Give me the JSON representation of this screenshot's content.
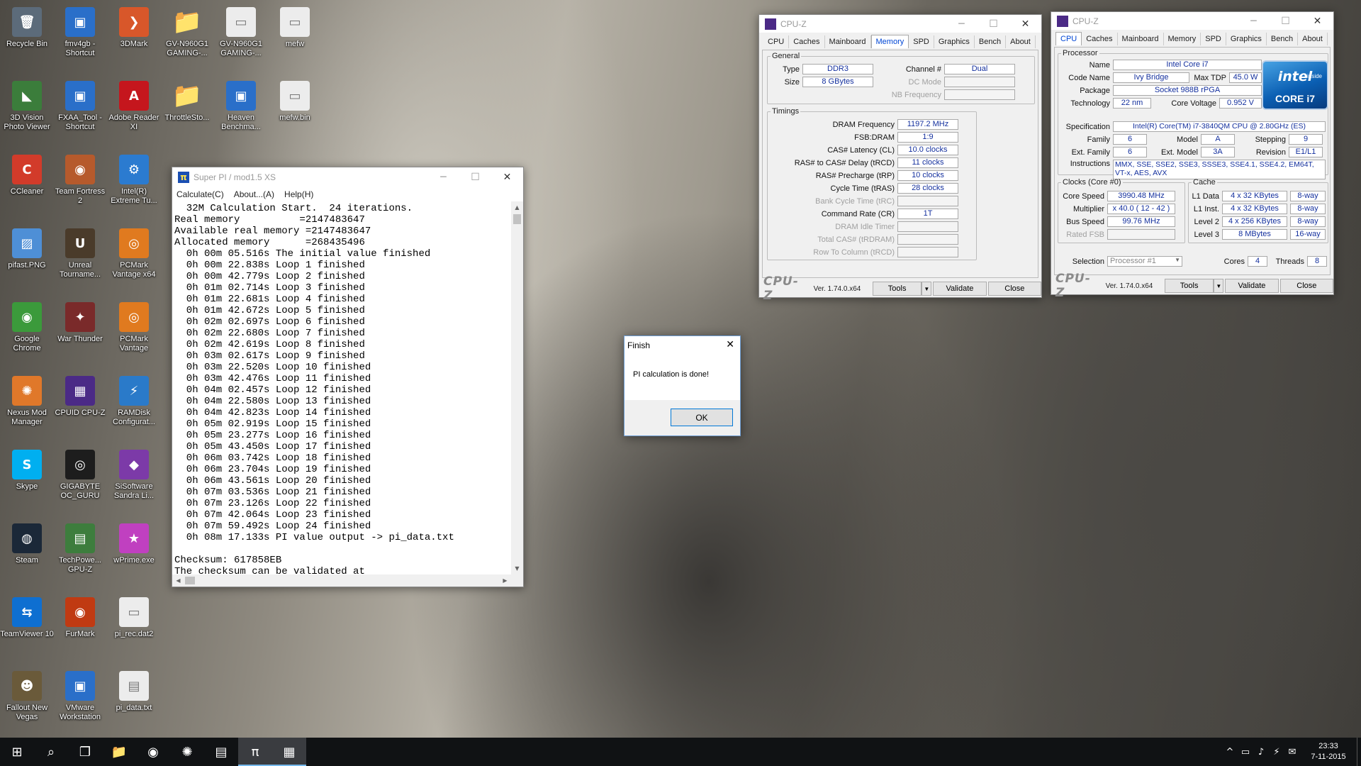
{
  "desktop": {
    "icons": [
      {
        "label": "Recycle Bin",
        "glyph": "🗑",
        "color": "#5c6b7a"
      },
      {
        "label": "fmv4gb - Shortcut",
        "glyph": "▣",
        "color": "#2a6fc9"
      },
      {
        "label": "3DMark",
        "glyph": "❯",
        "color": "#d8572a"
      },
      {
        "label": "GV-N960G1 GAMING-...",
        "glyph": "📁",
        "color": "#e8b94a"
      },
      {
        "label": "GV-N960G1 GAMING-...",
        "glyph": "▭",
        "color": "#ececec"
      },
      {
        "label": "mefw",
        "glyph": "▭",
        "color": "#ececec"
      },
      {
        "label": "3D Vision Photo Viewer",
        "glyph": "◣",
        "color": "#3b7d3b"
      },
      {
        "label": "FXAA_Tool - Shortcut",
        "glyph": "▣",
        "color": "#2a6fc9"
      },
      {
        "label": "Adobe Reader XI",
        "glyph": "A",
        "color": "#c5161d"
      },
      {
        "label": "ThrottleSto...",
        "glyph": "📁",
        "color": "#e8b94a"
      },
      {
        "label": "Heaven Benchma...",
        "glyph": "▣",
        "color": "#2a6fc9"
      },
      {
        "label": "mefw.bin",
        "glyph": "▭",
        "color": "#ececec"
      },
      {
        "label": "CCleaner",
        "glyph": "C",
        "color": "#d23b2a"
      },
      {
        "label": "Team Fortress 2",
        "glyph": "◉",
        "color": "#b65a2c"
      },
      {
        "label": "Intel(R) Extreme Tu...",
        "glyph": "⚙",
        "color": "#2b7bd0"
      },
      {
        "label": "pifast.PNG",
        "glyph": "▨",
        "color": "#4e8fd6"
      },
      {
        "label": "Unreal Tourname...",
        "glyph": "U",
        "color": "#4a3b2a"
      },
      {
        "label": "PCMark Vantage x64",
        "glyph": "◎",
        "color": "#e07a1f"
      },
      {
        "label": "Google Chrome",
        "glyph": "◉",
        "color": "#3b9a3b"
      },
      {
        "label": "War Thunder",
        "glyph": "✦",
        "color": "#7a2a2a"
      },
      {
        "label": "PCMark Vantage",
        "glyph": "◎",
        "color": "#e07a1f"
      },
      {
        "label": "Nexus Mod Manager",
        "glyph": "✺",
        "color": "#e0782a"
      },
      {
        "label": "CPUID CPU-Z",
        "glyph": "▦",
        "color": "#4b2a86"
      },
      {
        "label": "RAMDisk Configurat...",
        "glyph": "⚡",
        "color": "#2a7ac9"
      },
      {
        "label": "Skype",
        "glyph": "S",
        "color": "#00aff0"
      },
      {
        "label": "GIGABYTE OC_GURU",
        "glyph": "◎",
        "color": "#1d1d1d"
      },
      {
        "label": "SiSoftware Sandra Li...",
        "glyph": "◆",
        "color": "#7c3aa8"
      },
      {
        "label": "Steam",
        "glyph": "◍",
        "color": "#1b2838"
      },
      {
        "label": "TechPowe... GPU-Z",
        "glyph": "▤",
        "color": "#3d7d3d"
      },
      {
        "label": "wPrime.exe",
        "glyph": "★",
        "color": "#c040c0"
      },
      {
        "label": "TeamViewer 10",
        "glyph": "⇆",
        "color": "#0e6fd1"
      },
      {
        "label": "FurMark",
        "glyph": "◉",
        "color": "#c03a12"
      },
      {
        "label": "pi_rec.dat2",
        "glyph": "▭",
        "color": "#ececec"
      },
      {
        "label": "Fallout New Vegas",
        "glyph": "☻",
        "color": "#6a5a3a"
      },
      {
        "label": "VMware Workstation",
        "glyph": "▣",
        "color": "#2a6fc9"
      },
      {
        "label": "pi_data.txt",
        "glyph": "▤",
        "color": "#ececec"
      }
    ]
  },
  "superpi": {
    "title": "Super PI / mod1.5 XS",
    "menu": [
      "Calculate(C)",
      "About...(A)",
      "Help(H)"
    ],
    "console_lines": [
      "  32M Calculation Start.  24 iterations.",
      "Real memory          =2147483647",
      "Available real memory =2147483647",
      "Allocated memory      =268435496",
      "  0h 00m 05.516s The initial value finished",
      "  0h 00m 22.838s Loop 1 finished",
      "  0h 00m 42.779s Loop 2 finished",
      "  0h 01m 02.714s Loop 3 finished",
      "  0h 01m 22.681s Loop 4 finished",
      "  0h 01m 42.672s Loop 5 finished",
      "  0h 02m 02.697s Loop 6 finished",
      "  0h 02m 22.680s Loop 7 finished",
      "  0h 02m 42.619s Loop 8 finished",
      "  0h 03m 02.617s Loop 9 finished",
      "  0h 03m 22.520s Loop 10 finished",
      "  0h 03m 42.476s Loop 11 finished",
      "  0h 04m 02.457s Loop 12 finished",
      "  0h 04m 22.580s Loop 13 finished",
      "  0h 04m 42.823s Loop 14 finished",
      "  0h 05m 02.919s Loop 15 finished",
      "  0h 05m 23.277s Loop 16 finished",
      "  0h 05m 43.450s Loop 17 finished",
      "  0h 06m 03.742s Loop 18 finished",
      "  0h 06m 23.704s Loop 19 finished",
      "  0h 06m 43.561s Loop 20 finished",
      "  0h 07m 03.536s Loop 21 finished",
      "  0h 07m 23.126s Loop 22 finished",
      "  0h 07m 42.064s Loop 23 finished",
      "  0h 07m 59.492s Loop 24 finished",
      "  0h 08m 17.133s PI value output -> pi_data.txt",
      "",
      "Checksum: 617858EB",
      "The checksum can be validated at"
    ]
  },
  "finish_dialog": {
    "title": "Finish",
    "message": "PI calculation is done!",
    "ok_label": "OK"
  },
  "cpuz_common": {
    "title": "CPU-Z",
    "tabs": [
      "CPU",
      "Caches",
      "Mainboard",
      "Memory",
      "SPD",
      "Graphics",
      "Bench",
      "About"
    ],
    "logo": "CPU-Z",
    "version": "Ver. 1.74.0.x64",
    "tools_label": "Tools",
    "validate_label": "Validate",
    "close_label": "Close"
  },
  "cpuz_memory": {
    "active_tab": "Memory",
    "general_legend": "General",
    "type_label": "Type",
    "type_value": "DDR3",
    "size_label": "Size",
    "size_value": "8 GBytes",
    "channel_label": "Channel #",
    "channel_value": "Dual",
    "dcmode_label": "DC Mode",
    "nbfreq_label": "NB Frequency",
    "timings_legend": "Timings",
    "timings": [
      {
        "label": "DRAM Frequency",
        "value": "1197.2 MHz",
        "dim": false
      },
      {
        "label": "FSB:DRAM",
        "value": "1:9",
        "dim": false
      },
      {
        "label": "CAS# Latency (CL)",
        "value": "10.0 clocks",
        "dim": false
      },
      {
        "label": "RAS# to CAS# Delay (tRCD)",
        "value": "11 clocks",
        "dim": false
      },
      {
        "label": "RAS# Precharge (tRP)",
        "value": "10 clocks",
        "dim": false
      },
      {
        "label": "Cycle Time (tRAS)",
        "value": "28 clocks",
        "dim": false
      },
      {
        "label": "Bank Cycle Time (tRC)",
        "value": "",
        "dim": true
      },
      {
        "label": "Command Rate (CR)",
        "value": "1T",
        "dim": false
      },
      {
        "label": "DRAM Idle Timer",
        "value": "",
        "dim": true
      },
      {
        "label": "Total CAS# (tRDRAM)",
        "value": "",
        "dim": true
      },
      {
        "label": "Row To Column (tRCD)",
        "value": "",
        "dim": true
      }
    ]
  },
  "cpuz_cpu": {
    "active_tab": "CPU",
    "processor_legend": "Processor",
    "name_label": "Name",
    "name_value": "Intel Core i7",
    "codename_label": "Code Name",
    "codename_value": "Ivy Bridge",
    "maxtdp_label": "Max TDP",
    "maxtdp_value": "45.0 W",
    "package_label": "Package",
    "package_value": "Socket 988B rPGA",
    "technology_label": "Technology",
    "technology_value": "22 nm",
    "corevoltage_label": "Core Voltage",
    "corevoltage_value": "0.952 V",
    "spec_label": "Specification",
    "spec_value": "Intel(R) Core(TM) i7-3840QM CPU @ 2.80GHz (ES)",
    "family_label": "Family",
    "family_value": "6",
    "model_label": "Model",
    "model_value": "A",
    "stepping_label": "Stepping",
    "stepping_value": "9",
    "extfamily_label": "Ext. Family",
    "extfamily_value": "6",
    "extmodel_label": "Ext. Model",
    "extmodel_value": "3A",
    "revision_label": "Revision",
    "revision_value": "E1/L1",
    "instructions_label": "Instructions",
    "instructions_value": "MMX, SSE, SSE2, SSE3, SSSE3, SSE4.1, SSE4.2, EM64T, VT-x, AES, AVX",
    "intel_brand": "intel",
    "intel_inside": "inside",
    "intel_core": "CORE i7",
    "clocks_legend": "Clocks (Core #0)",
    "corespeed_label": "Core Speed",
    "corespeed_value": "3990.48 MHz",
    "multiplier_label": "Multiplier",
    "multiplier_value": "x 40.0 ( 12 - 42 )",
    "busspeed_label": "Bus Speed",
    "busspeed_value": "99.76 MHz",
    "ratedfsb_label": "Rated FSB",
    "cache_legend": "Cache",
    "cache": [
      {
        "label": "L1 Data",
        "size": "4 x 32 KBytes",
        "way": "8-way"
      },
      {
        "label": "L1 Inst.",
        "size": "4 x 32 KBytes",
        "way": "8-way"
      },
      {
        "label": "Level 2",
        "size": "4 x 256 KBytes",
        "way": "8-way"
      },
      {
        "label": "Level 3",
        "size": "8 MBytes",
        "way": "16-way"
      }
    ],
    "selection_label": "Selection",
    "selection_value": "Processor #1",
    "cores_label": "Cores",
    "cores_value": "4",
    "threads_label": "Threads",
    "threads_value": "8"
  },
  "taskbar": {
    "start": "⊞",
    "search": "⌕",
    "taskview": "❐",
    "apps": [
      {
        "name": "explorer",
        "glyph": "📁",
        "active": false
      },
      {
        "name": "chrome",
        "glyph": "◉",
        "active": false
      },
      {
        "name": "gpu-tool",
        "glyph": "✺",
        "active": false
      },
      {
        "name": "news-app",
        "glyph": "▤",
        "active": false
      },
      {
        "name": "superpi",
        "glyph": "π",
        "active": true
      },
      {
        "name": "cpuz",
        "glyph": "▦",
        "active": true
      }
    ],
    "tray": [
      "^",
      "▭",
      "♪",
      "⚡",
      "✉"
    ],
    "time": "23:33",
    "date": "7-11-2015"
  }
}
